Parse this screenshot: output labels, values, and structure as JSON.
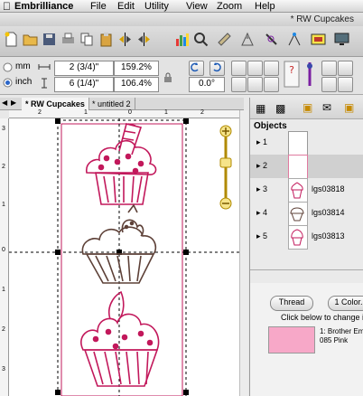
{
  "menubar": {
    "app_name": "Embrilliance",
    "items": [
      "File",
      "Edit",
      "Utility",
      "View",
      "Zoom",
      "Help"
    ]
  },
  "window": {
    "title": "* RW Cupcakes"
  },
  "toolbar": {
    "label_3d": "3D"
  },
  "props": {
    "unit_mm": "mm",
    "unit_inch": "inch",
    "selected_unit": "inch",
    "width_value": "2 (3/4)\"",
    "width_percent": "159.2%",
    "height_value": "6 (1/4)\"",
    "height_percent": "106.4%",
    "rotation_value": "0.0°"
  },
  "tabs": [
    {
      "label": "* RW Cupcakes",
      "active": true
    },
    {
      "label": "* untitled 2",
      "active": false
    }
  ],
  "ruler": {
    "h_ticks": [
      "2",
      "1",
      "0",
      "1",
      "2"
    ],
    "v_ticks": [
      "3",
      "2",
      "1",
      "0",
      "1",
      "2",
      "3"
    ]
  },
  "objects": {
    "header": "Objects",
    "rows": [
      {
        "num": "1",
        "label": "",
        "color": "#ffffff"
      },
      {
        "num": "2",
        "label": "",
        "color": "#ffffff"
      },
      {
        "num": "3",
        "label": "lgs03818",
        "color": "#c2185b"
      },
      {
        "num": "4",
        "label": "lgs03814",
        "color": "#5d4037"
      },
      {
        "num": "5",
        "label": "lgs03813",
        "color": "#c2185b"
      }
    ]
  },
  "thread_panel": {
    "thread_button": "Thread",
    "color_button": "1 Color.",
    "hint": "Click below to change in",
    "swatch_color": "#f7a8c8",
    "thread_line1": "1: Brother Em",
    "thread_line2": "085 Pink"
  },
  "colors": {
    "pink": "#c2185b",
    "brown": "#5d4037",
    "swatch": "#f7a8c8"
  }
}
